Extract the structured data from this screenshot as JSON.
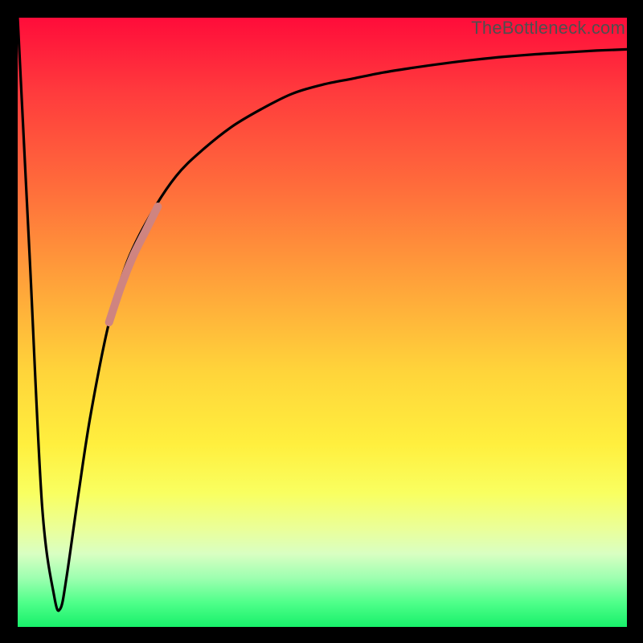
{
  "watermark": "TheBottleneck.com",
  "colors": {
    "frame": "#000000",
    "curve": "#000000",
    "highlight": "#cf8480",
    "watermark_text": "#4f4f4f"
  },
  "chart_data": {
    "type": "line",
    "title": "",
    "xlabel": "",
    "ylabel": "",
    "xlim": [
      0,
      100
    ],
    "ylim": [
      0,
      100
    ],
    "grid": false,
    "legend": false,
    "note": "Bottleneck-percentage curve on a rainbow gradient. No axis ticks or numeric labels are shown; values below are estimated from pixel positions. y=0 is bottom (green/0% bottleneck), y=100 is top (red/100% bottleneck).",
    "series": [
      {
        "name": "bottleneck_curve",
        "x": [
          0,
          2,
          4,
          6,
          7,
          8,
          10,
          12,
          15,
          18,
          22,
          26,
          30,
          35,
          40,
          45,
          50,
          55,
          60,
          65,
          70,
          75,
          80,
          85,
          90,
          95,
          100
        ],
        "y": [
          100,
          60,
          20,
          5,
          3,
          8,
          22,
          35,
          50,
          60,
          68,
          74,
          78,
          82,
          85,
          87.5,
          89,
          90,
          91,
          91.8,
          92.5,
          93.1,
          93.6,
          94,
          94.3,
          94.6,
          94.8
        ]
      },
      {
        "name": "highlighted_segment",
        "x": [
          15,
          17,
          19,
          21,
          23
        ],
        "y": [
          50,
          56,
          61,
          65,
          69
        ]
      }
    ]
  }
}
